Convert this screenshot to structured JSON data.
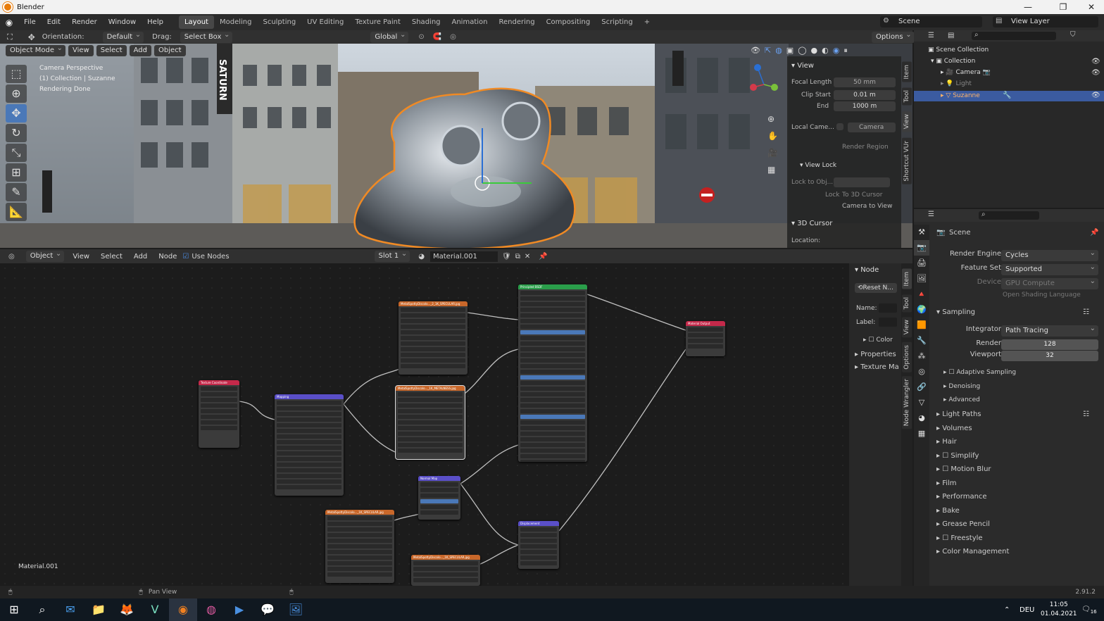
{
  "window": {
    "title": "Blender",
    "min": "—",
    "max": "❐",
    "close": "✕"
  },
  "menus": [
    "File",
    "Edit",
    "Render",
    "Window",
    "Help"
  ],
  "workspaces": [
    "Layout",
    "Modeling",
    "Sculpting",
    "UV Editing",
    "Texture Paint",
    "Shading",
    "Animation",
    "Rendering",
    "Compositing",
    "Scripting"
  ],
  "workspace_add": "+",
  "scene_field": "Scene",
  "view_layer_field": "View Layer",
  "vp_header": {
    "orientation_label": "Orientation:",
    "orientation_value": "Default",
    "drag_label": "Drag:",
    "drag_value": "Select Box",
    "transform": "Global",
    "options": "Options",
    "mode": "Object Mode",
    "view": "View",
    "select": "Select",
    "add": "Add",
    "object": "Object"
  },
  "viewport_overlay": {
    "line1": "Camera Perspective",
    "line2": "(1) Collection | Suzanne",
    "line3": "Rendering Done",
    "sign": "SATURN"
  },
  "npanel": {
    "view_header": "View",
    "focal_length_label": "Focal Length",
    "focal_length": "50 mm",
    "clip_start_label": "Clip Start",
    "clip_start": "0.01 m",
    "end_label": "End",
    "end": "1000 m",
    "local_camera_label": "Local Came...",
    "local_camera": "Camera",
    "render_region": "Render Region",
    "view_lock_header": "View Lock",
    "lock_to_obj": "Lock to Obj...",
    "lock_label": "Lock",
    "to_3d_cursor": "To 3D Cursor",
    "camera_to_view": "Camera to View",
    "cursor_header": "3D Cursor",
    "location_label": "Location:",
    "tabs": [
      "Item",
      "Tool",
      "View",
      "Shortcut VUr"
    ]
  },
  "outliner": {
    "scene_collection": "Scene Collection",
    "collection": "Collection",
    "items": [
      "Camera",
      "Light",
      "Suzanne"
    ]
  },
  "ne_header": {
    "editor": "Object",
    "view": "View",
    "select": "Select",
    "add": "Add",
    "node": "Node",
    "use_nodes": "Use Nodes",
    "slot": "Slot 1",
    "material": "Material.001"
  },
  "ne_npanel": {
    "node_header": "Node",
    "reset": "Reset N...",
    "name_label": "Name:",
    "label_label": "Label:",
    "color": "Color",
    "properties": "Properties",
    "texture": "Texture Ma",
    "tabs": [
      "Item",
      "Tool",
      "View",
      "Options",
      "Node Wrangler"
    ]
  },
  "ne_footer": "Material.001",
  "nodes": [
    {
      "title": "Texture Coordinate",
      "color": "#c4294a"
    },
    {
      "title": "Mapping",
      "color": "#5a4fc8"
    },
    {
      "title": "MetalSpottyDiscolo..._2_1K_SPECULAR.jpg",
      "color": "#c8672a"
    },
    {
      "title": "MetalSpottyDiscolo..._1K_METALNESS.jpg",
      "color": "#c8672a"
    },
    {
      "title": "Principled BSDF",
      "color": "#2a9e4a"
    },
    {
      "title": "Material Output",
      "color": "#c4294a"
    },
    {
      "title": "Normal Map",
      "color": "#5a4fc8"
    },
    {
      "title": "Displacement",
      "color": "#5a4fc8"
    },
    {
      "title": "MetalSpottyDiscolo..._1K_SPECULAR.jpg",
      "color": "#c8672a"
    },
    {
      "title": "MetalSpottyDiscolo..._1K_SPECULAR.jpg",
      "color": "#c8672a"
    }
  ],
  "props": {
    "scene_label": "Scene",
    "render_engine_label": "Render Engine",
    "render_engine": "Cycles",
    "feature_set_label": "Feature Set",
    "feature_set": "Supported",
    "device_label": "Device",
    "device": "GPU Compute",
    "osl": "Open Shading Language",
    "sampling": "Sampling",
    "integrator_label": "Integrator",
    "integrator": "Path Tracing",
    "render_label": "Render",
    "render": "128",
    "viewport_label": "Viewport",
    "viewport": "32",
    "adaptive": "Adaptive Sampling",
    "denoising": "Denoising",
    "advanced": "Advanced",
    "panels": [
      "Light Paths",
      "Volumes",
      "Hair",
      "Simplify",
      "Motion Blur",
      "Film",
      "Performance",
      "Bake",
      "Grease Pencil",
      "Freestyle",
      "Color Management"
    ]
  },
  "status": {
    "pan": "Pan View",
    "version": "2.91.2"
  },
  "taskbar": {
    "lang": "DEU",
    "time": "11:05",
    "date": "01.04.2021",
    "notif": "16"
  }
}
